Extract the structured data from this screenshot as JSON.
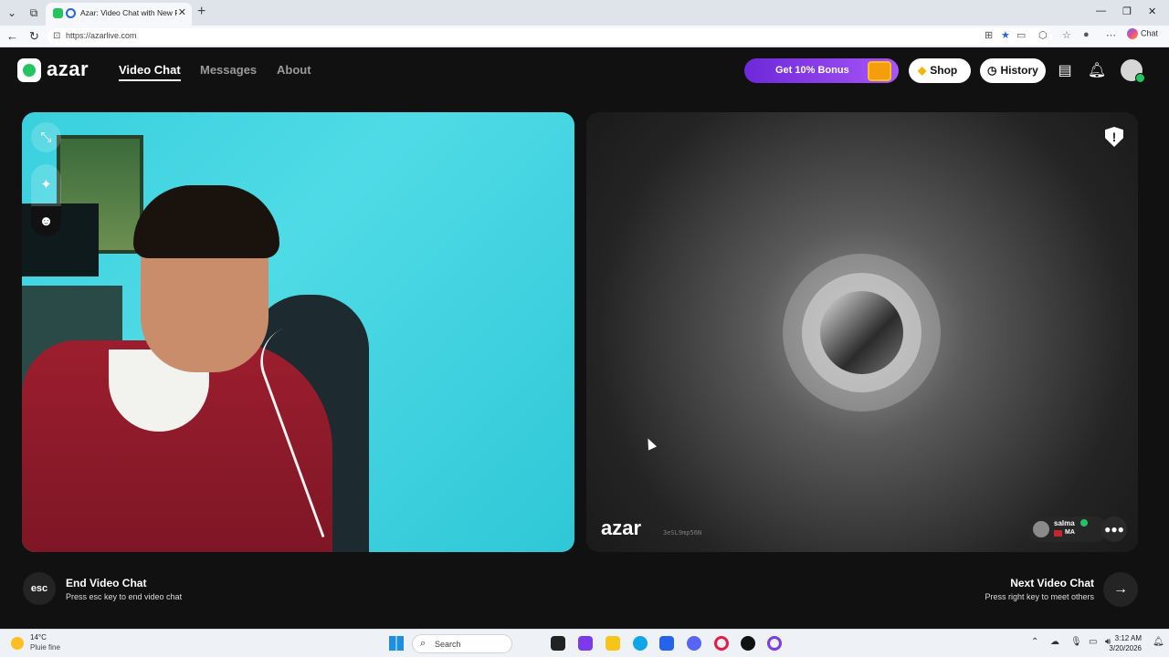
{
  "browser": {
    "tab_title": "Azar: Video Chat with New Pe",
    "url": "https://azarlive.com",
    "copilot_label": "Chat"
  },
  "header": {
    "logo_text": "azar",
    "nav": [
      {
        "label": "Video Chat",
        "active": true
      },
      {
        "label": "Messages",
        "active": false
      },
      {
        "label": "About",
        "active": false
      }
    ],
    "bonus_label": "Get 10% Bonus",
    "shop_label": "Shop",
    "history_label": "History"
  },
  "remote": {
    "watermark": "azar",
    "session_id": "3eSL9mp56N",
    "peer_name": "salma",
    "peer_country": "MA"
  },
  "footer": {
    "esc_label": "esc",
    "end_title": "End Video Chat",
    "end_subtitle": "Press esc key to end video chat",
    "next_title": "Next Video Chat",
    "next_subtitle": "Press right key to meet others"
  },
  "taskbar": {
    "temperature": "14°C",
    "condition": "Pluie fine",
    "search_label": "Search",
    "time": "3:12 AM",
    "date": "3/20/2026"
  },
  "colors": {
    "accent_green": "#22c55e",
    "bonus_purple": "#7c3aed",
    "app_background": "#111111"
  }
}
